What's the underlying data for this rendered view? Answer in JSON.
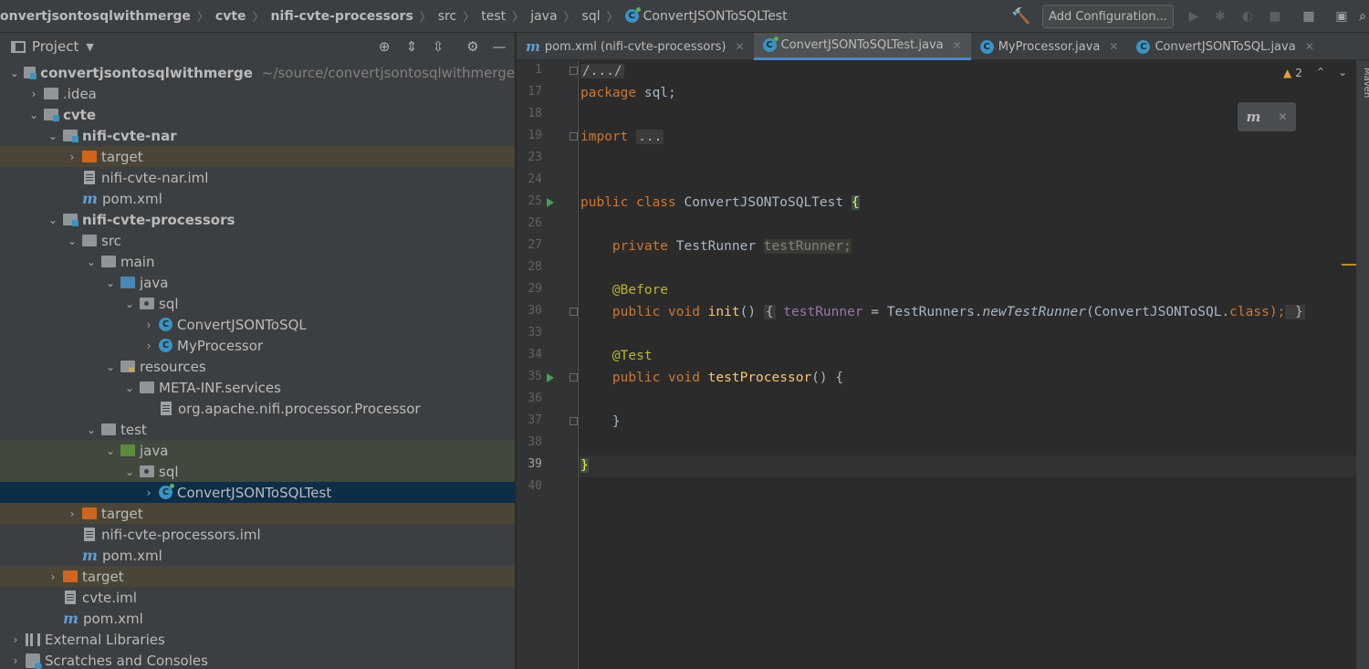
{
  "breadcrumb": [
    "onvertjsontosqlwithmerge",
    "cvte",
    "nifi-cvte-processors",
    "src",
    "test",
    "java",
    "sql",
    "ConvertJSONToSQLTest"
  ],
  "toolbar": {
    "add_configuration": "Add Configuration..."
  },
  "project_panel": {
    "title": "Project"
  },
  "tree": [
    {
      "label": "convertjsontosqlwithmerge",
      "path": "~/source/convertjsontosqlwithmerge"
    },
    {
      "label": ".idea"
    },
    {
      "label": "cvte"
    },
    {
      "label": "nifi-cvte-nar"
    },
    {
      "label": "target"
    },
    {
      "label": "nifi-cvte-nar.iml"
    },
    {
      "label": "pom.xml"
    },
    {
      "label": "nifi-cvte-processors"
    },
    {
      "label": "src"
    },
    {
      "label": "main"
    },
    {
      "label": "java"
    },
    {
      "label": "sql"
    },
    {
      "label": "ConvertJSONToSQL"
    },
    {
      "label": "MyProcessor"
    },
    {
      "label": "resources"
    },
    {
      "label": "META-INF.services"
    },
    {
      "label": "org.apache.nifi.processor.Processor"
    },
    {
      "label": "test"
    },
    {
      "label": "java"
    },
    {
      "label": "sql"
    },
    {
      "label": "ConvertJSONToSQLTest"
    },
    {
      "label": "target"
    },
    {
      "label": "nifi-cvte-processors.iml"
    },
    {
      "label": "pom.xml"
    },
    {
      "label": "target"
    },
    {
      "label": "cvte.iml"
    },
    {
      "label": "pom.xml"
    },
    {
      "label": "External Libraries"
    },
    {
      "label": "Scratches and Consoles"
    }
  ],
  "tabs": [
    {
      "label": "pom.xml (nifi-cvte-processors)"
    },
    {
      "label": "ConvertJSONToSQLTest.java"
    },
    {
      "label": "MyProcessor.java"
    },
    {
      "label": "ConvertJSONToSQL.java"
    }
  ],
  "line_numbers": [
    "1",
    "17",
    "18",
    "19",
    "23",
    "24",
    "25",
    "26",
    "27",
    "28",
    "29",
    "30",
    "33",
    "34",
    "35",
    "36",
    "37",
    "38",
    "39",
    "40"
  ],
  "code": {
    "l1": "/.../",
    "l17_kw": "package",
    "l17_rest": " sql;",
    "l19_kw": "import",
    "l19_fold": "...",
    "l25_kw": "public class",
    "l25_name": " ConvertJSONToSQLTest ",
    "l25_brace": "{",
    "l27_kw": "private",
    "l27_type": " TestRunner ",
    "l27_field": "testRunner",
    "l27_semi": ";",
    "l29_ann": "@Before",
    "l30_kw": "public void",
    "l30_fn": " init",
    "l30_paren": "() ",
    "l30_b1": "{",
    "l30_field": " testRunner",
    "l30_eq": " = TestRunners.",
    "l30_call": "newTestRunner",
    "l30_arg": "(ConvertJSONToSQL.",
    "l30_cls": "class",
    "l30_end": ");",
    "l30_b2": " }",
    "l34_ann": "@Test",
    "l35_kw": "public void",
    "l35_fn": " testProcessor",
    "l35_rest": "() {",
    "l37": "}",
    "l39": "}"
  },
  "warnings": {
    "count": "2"
  },
  "right_strip": {
    "label": "Maven"
  },
  "colors": {
    "accent": "#4a88c7",
    "keyword": "#cc7832",
    "annotation": "#bbb529",
    "field": "#9876aa",
    "function": "#ffc66d"
  }
}
